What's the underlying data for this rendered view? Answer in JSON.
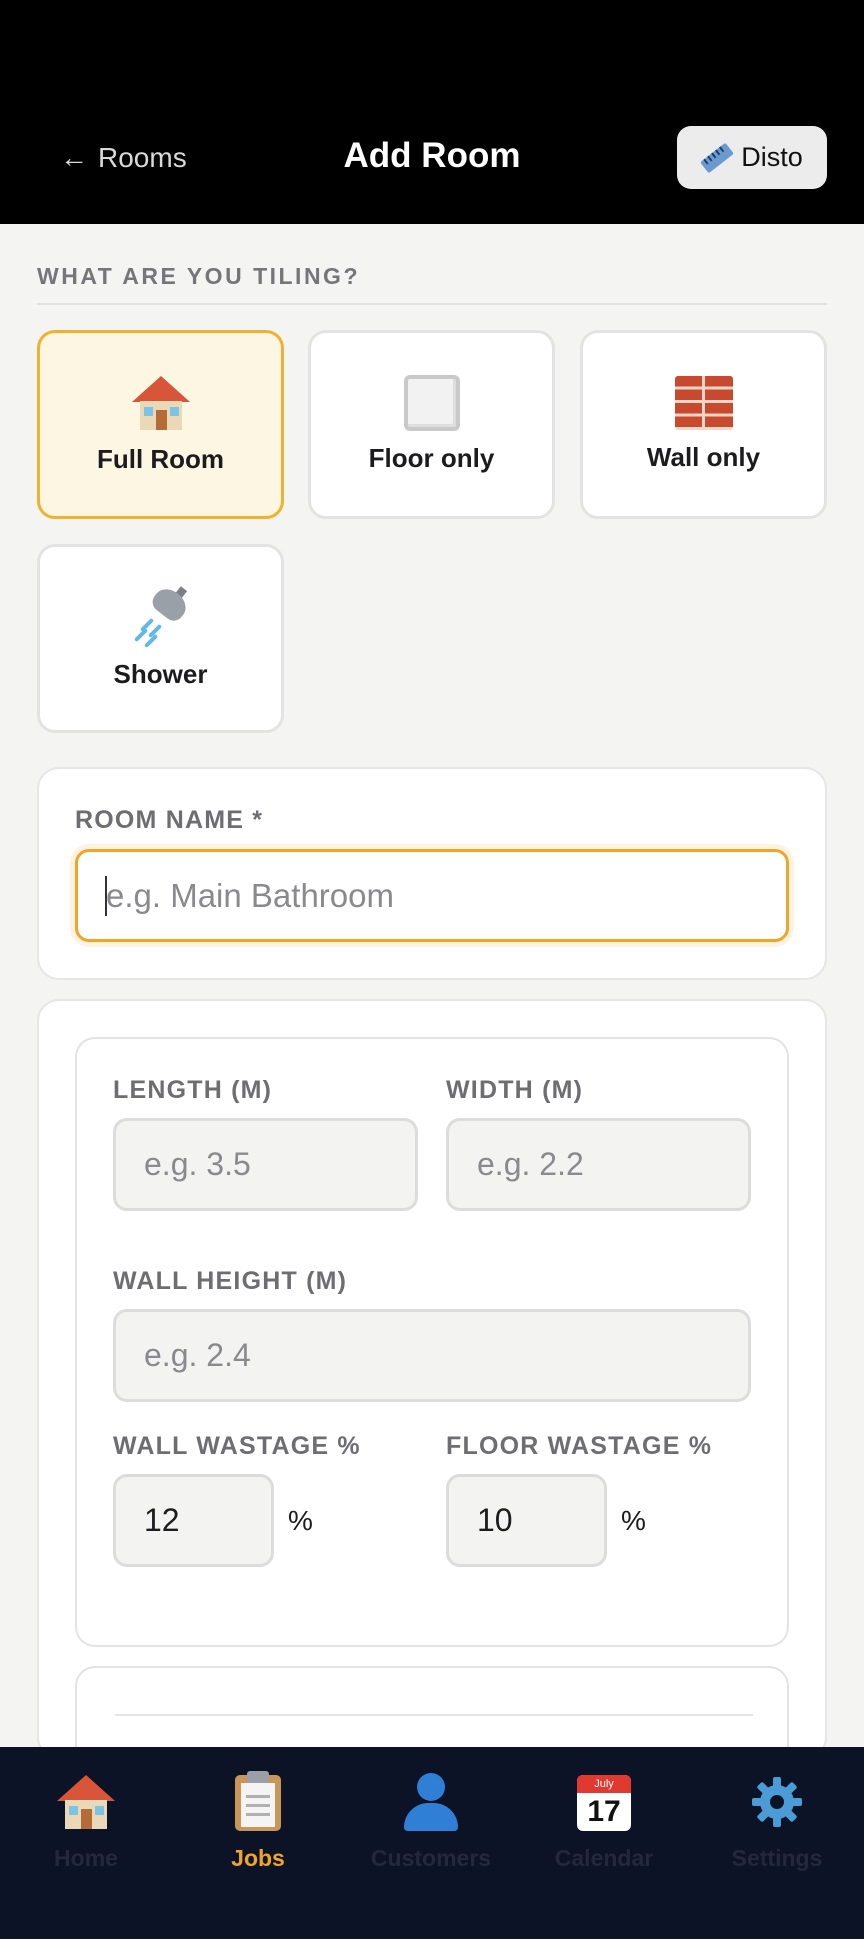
{
  "header": {
    "back_label": "Rooms",
    "title": "Add Room",
    "disto_label": "Disto"
  },
  "tiling": {
    "section_label": "WHAT ARE YOU TILING?",
    "options": [
      {
        "label": "Full Room",
        "icon": "house-icon",
        "selected": true
      },
      {
        "label": "Floor only",
        "icon": "white-square-icon",
        "selected": false
      },
      {
        "label": "Wall only",
        "icon": "brick-icon",
        "selected": false
      },
      {
        "label": "Shower",
        "icon": "shower-icon",
        "selected": false
      }
    ]
  },
  "room_name": {
    "label": "ROOM NAME *",
    "value": "",
    "placeholder": "e.g. Main Bathroom"
  },
  "dimensions": {
    "length": {
      "label": "LENGTH (M)",
      "value": "",
      "placeholder": "e.g. 3.5"
    },
    "width": {
      "label": "WIDTH (M)",
      "value": "",
      "placeholder": "e.g. 2.2"
    },
    "wall_height": {
      "label": "WALL HEIGHT (M)",
      "value": "",
      "placeholder": "e.g. 2.4"
    },
    "wall_wastage": {
      "label": "WALL WASTAGE %",
      "value": "12",
      "unit": "%"
    },
    "floor_wastage": {
      "label": "FLOOR WASTAGE %",
      "value": "10",
      "unit": "%"
    }
  },
  "bottom_nav": {
    "items": [
      {
        "label": "Home",
        "icon": "house-icon",
        "active": false
      },
      {
        "label": "Jobs",
        "icon": "clipboard-icon",
        "active": true
      },
      {
        "label": "Customers",
        "icon": "user-icon",
        "active": false
      },
      {
        "label": "Calendar",
        "icon": "calendar-icon",
        "active": false,
        "calendar_month": "July",
        "calendar_day": "17"
      },
      {
        "label": "Settings",
        "icon": "gear-icon",
        "active": false
      }
    ]
  },
  "colors": {
    "accent": "#f0a528",
    "selected_bg": "#fdf6e3",
    "nav_bg": "#0d1326",
    "header_bg": "#000000"
  }
}
